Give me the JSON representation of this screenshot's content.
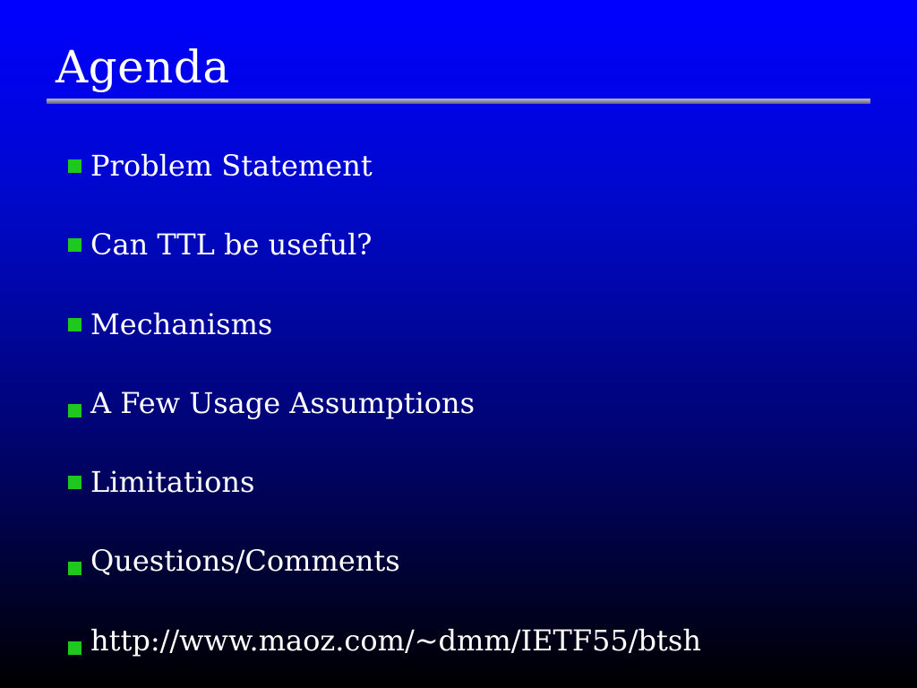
{
  "slide": {
    "title": "Agenda",
    "bullets": [
      {
        "text": "Problem Statement"
      },
      {
        "text": "Can TTL be useful?"
      },
      {
        "text": "Mechanisms"
      },
      {
        "text": "A Few Usage Assumptions"
      },
      {
        "text": "Limitations"
      },
      {
        "text": "Questions/Comments"
      },
      {
        "text": "http://www.maoz.com/~dmm/IETF55/btsh"
      }
    ]
  },
  "colors": {
    "background_top": "#0000ff",
    "background_bottom": "#000000",
    "bullet": "#1ec81e",
    "text": "#ffffff"
  }
}
